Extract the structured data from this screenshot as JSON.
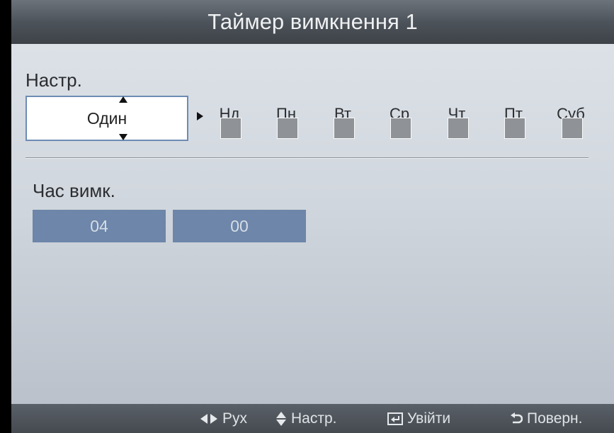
{
  "dialog": {
    "title": "Таймер вимкнення 1"
  },
  "repeat": {
    "label": "Настр.",
    "value": "Один"
  },
  "days": [
    {
      "label": "Нд",
      "checked": false
    },
    {
      "label": "Пн",
      "checked": false
    },
    {
      "label": "Вт",
      "checked": false
    },
    {
      "label": "Ср",
      "checked": false
    },
    {
      "label": "Чт",
      "checked": false
    },
    {
      "label": "Пт",
      "checked": false
    },
    {
      "label": "Суб",
      "checked": false
    }
  ],
  "off_time": {
    "label": "Час вимк.",
    "hour": "04",
    "minute": "00"
  },
  "footer": {
    "move": {
      "icon": "left-right-arrows-icon",
      "label": "Рух"
    },
    "adjust": {
      "icon": "up-down-arrows-icon",
      "label": "Настр."
    },
    "enter": {
      "icon": "enter-icon",
      "label": "Увійти"
    },
    "back": {
      "icon": "return-icon",
      "label": "Поверн."
    }
  },
  "colors": {
    "title_bar": "#4d535a",
    "panel": "#d1d7de",
    "time_field": "#6d86a9",
    "checkbox": "#8f9296",
    "selection_border": "#6d8cb4"
  }
}
